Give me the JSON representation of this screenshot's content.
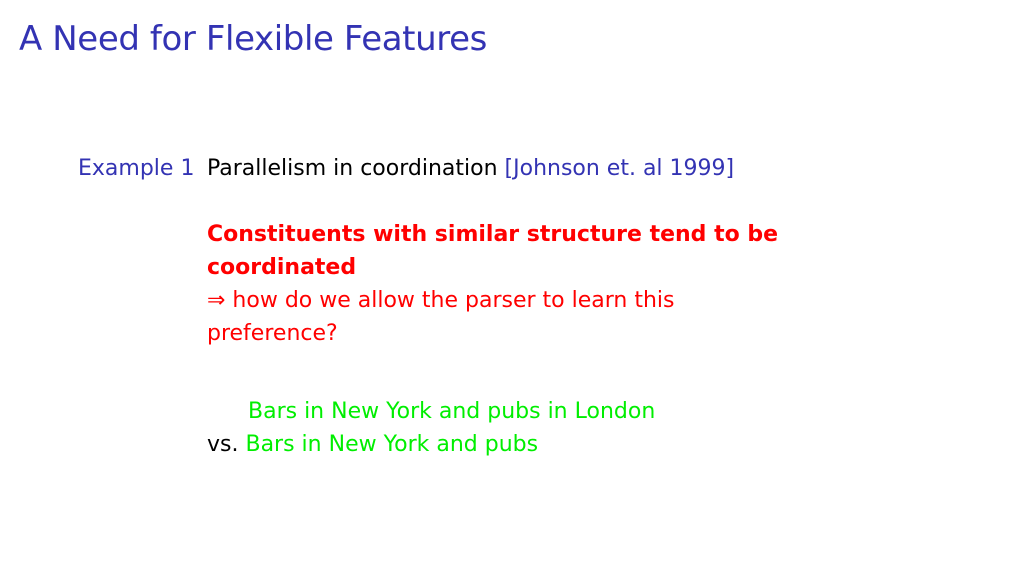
{
  "slide": {
    "title": "A Need for Flexible Features"
  },
  "example": {
    "label": "Example 1",
    "heading": "Parallelism in coordination",
    "citation": "[Johnson et. al 1999]",
    "claim": "Constituents with similar structure tend to be coordinated",
    "question": "⇒ how do we allow the parser to learn this preference?",
    "phrase_1": "Bars in New York and pubs in London",
    "vs_label": "vs.",
    "phrase_2": "Bars in New York and pubs"
  },
  "colors": {
    "title": "#3333b3",
    "claim": "#ff0000",
    "examples": "#00ee00"
  }
}
